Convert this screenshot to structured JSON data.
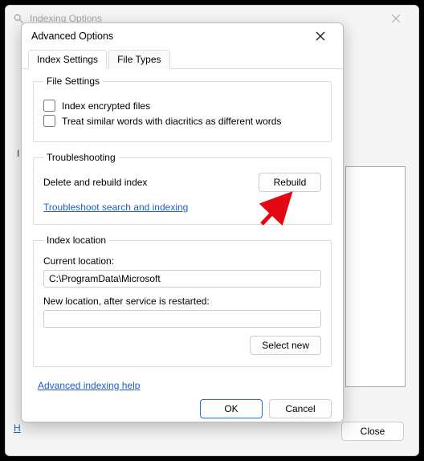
{
  "outer": {
    "title": "Indexing Options",
    "close_button": "Close",
    "label_i": "I",
    "partial_link": "H"
  },
  "inner": {
    "title": "Advanced Options",
    "tabs": [
      {
        "label": "Index Settings"
      },
      {
        "label": "File Types"
      }
    ],
    "file_settings": {
      "legend": "File Settings",
      "encrypted_label": "Index encrypted files",
      "diacritics_label": "Treat similar words with diacritics as different words"
    },
    "troubleshooting": {
      "legend": "Troubleshooting",
      "rebuild_label": "Delete and rebuild index",
      "rebuild_button": "Rebuild",
      "troubleshoot_link": "Troubleshoot search and indexing"
    },
    "index_location": {
      "legend": "Index location",
      "current_label": "Current location:",
      "current_value": "C:\\ProgramData\\Microsoft",
      "new_label": "New location, after service is restarted:",
      "new_value": "",
      "select_new_button": "Select new"
    },
    "advanced_help_link": "Advanced indexing help",
    "ok_button": "OK",
    "cancel_button": "Cancel"
  }
}
